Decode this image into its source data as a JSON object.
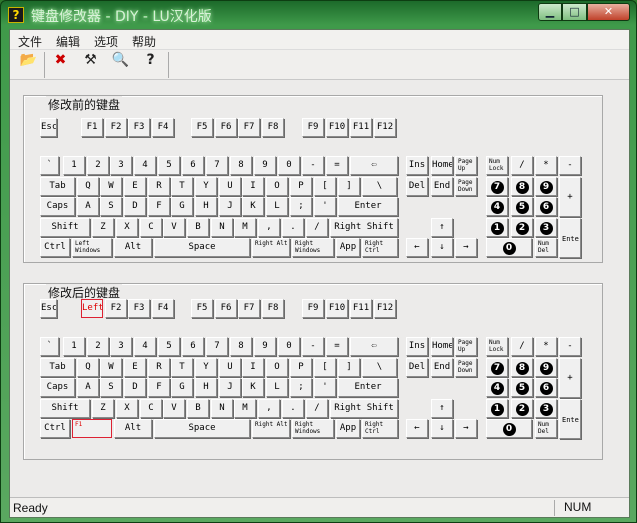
{
  "window": {
    "title": "键盘修改器 - DIY - LU汉化版",
    "app_icon": "?",
    "min": "▁",
    "max": "□",
    "close": "✕"
  },
  "menu": [
    "文件",
    "编辑",
    "选项",
    "帮助"
  ],
  "toolbar": [
    {
      "name": "load-icon",
      "glyph": "📂"
    },
    {
      "name": "remap-icon",
      "glyph": "✖"
    },
    {
      "name": "build-icon",
      "glyph": "⚒"
    },
    {
      "name": "preview-icon",
      "glyph": "🔍"
    },
    {
      "name": "help-icon",
      "glyph": "?"
    }
  ],
  "groups": {
    "before": "修改前的键盘",
    "after": "修改后的键盘"
  },
  "keyboards": {
    "before": {
      "Esc": "Esc",
      "F1": "F1",
      "CapsLock": "Caps",
      "LCtrl": "Ctrl"
    },
    "after": {
      "Esc": "Esc",
      "F1": "Left",
      "CapsLock": "Caps",
      "LCtrl": "Ctrl",
      "LWin": "F1"
    }
  },
  "keys": {
    "f2": "F2",
    "f3": "F3",
    "f4": "F4",
    "f5": "F5",
    "f6": "F6",
    "f7": "F7",
    "f8": "F8",
    "f9": "F9",
    "f10": "F10",
    "f11": "F11",
    "f12": "F12",
    "backtick": "`",
    "n1": "1",
    "n2": "2",
    "n3": "3",
    "n4": "4",
    "n5": "5",
    "n6": "6",
    "n7": "7",
    "n8": "8",
    "n9": "9",
    "n0": "0",
    "minus": "-",
    "equal": "=",
    "backspace": "⇦",
    "tab": "Tab",
    "q": "Q",
    "w": "W",
    "e": "E",
    "r": "R",
    "t": "T",
    "y": "Y",
    "u": "U",
    "i": "I",
    "o": "O",
    "p": "P",
    "lbr": "[",
    "rbr": "]",
    "bslash": "\\",
    "a": "A",
    "s": "S",
    "d": "D",
    "f": "F",
    "g": "G",
    "h": "H",
    "j": "J",
    "k": "K",
    "l": "L",
    "semi": ";",
    "quote": "'",
    "enter": "Enter",
    "shift": "Shift",
    "z": "Z",
    "x": "X",
    "c": "C",
    "v": "V",
    "b": "B",
    "n": "N",
    "m": "M",
    "comma": ",",
    "period": ".",
    "slash": "/",
    "rshift": "Right Shift",
    "lwin": "Left Windows",
    "alt": "Alt",
    "space": "Space",
    "ralt": "Right Alt",
    "rwin": "Right Windows",
    "app": "App",
    "rctrl": "Right Ctrl",
    "ins": "Ins",
    "home": "Home",
    "pgup": "Page Up",
    "del": "Del",
    "end": "End",
    "pgdn": "Page Down",
    "up": "↑",
    "left": "←",
    "down": "↓",
    "right": "→",
    "numlock": "Num Lock",
    "numdiv": "/",
    "nummul": "*",
    "numsub": "-",
    "kp7": "7",
    "kp8": "8",
    "kp9": "9",
    "numadd": "+",
    "kp4": "4",
    "kp5": "5",
    "kp6": "6",
    "kp1": "1",
    "kp2": "2",
    "kp3": "3",
    "numenter": "Enter",
    "kp0": "0",
    "numdel": "Num Del"
  },
  "status": {
    "text": "Ready",
    "num": "NUM"
  }
}
